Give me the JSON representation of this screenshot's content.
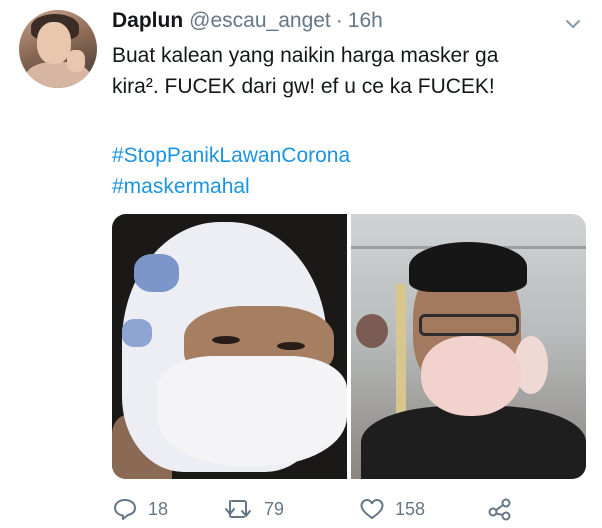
{
  "tweet": {
    "display_name": "Daplun",
    "handle": "@escau_anget",
    "separator": "·",
    "time": "16h",
    "text_lines": [
      "Buat kalean yang naikin harga masker ga",
      "kira². FUCEK dari gw! ef u ce ka FUCEK!"
    ],
    "hashtags": [
      "#StopPanikLawanCorona",
      "#maskermahal"
    ]
  },
  "actions": {
    "reply_count": "18",
    "retweet_count": "79",
    "like_count": "158"
  },
  "icons": {
    "avatar": "user-avatar",
    "caret": "chevron-down-icon",
    "reply": "reply-icon",
    "retweet": "retweet-icon",
    "like": "heart-icon",
    "share": "share-icon"
  },
  "colors": {
    "text": "#14171a",
    "secondary": "#657786",
    "hashtag": "#1b95e0"
  }
}
